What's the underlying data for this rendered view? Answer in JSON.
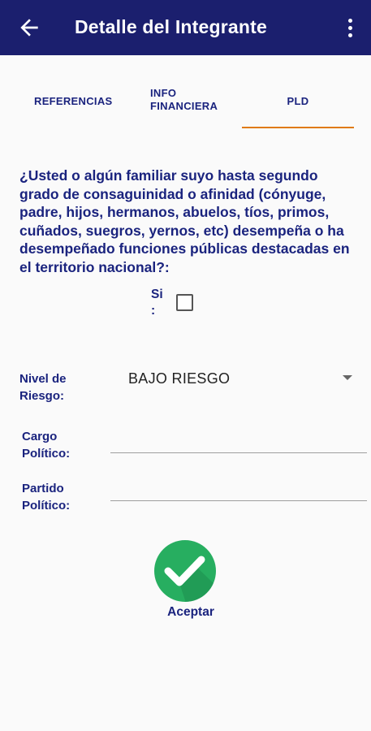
{
  "appbar": {
    "title": "Detalle del Integrante",
    "back_icon": "arrow-back-icon",
    "menu_icon": "more-vert-icon",
    "color": "#1b1f6e"
  },
  "tabs": [
    {
      "label": "REFERENCIAS",
      "selected": false
    },
    {
      "label_line1": "INFO",
      "label_line2": "FINANCIERA",
      "selected": false
    },
    {
      "label": "PLD",
      "selected": true
    }
  ],
  "tab_indicator_color": "#e07b12",
  "form": {
    "question": "¿Usted o algún familiar suyo hasta segundo grado de consaguinidad o afinidad (cónyuge, padre, hijos, hermanos, abuelos, tíos, primos, cuñados, suegros, yernos, etc) desempeña o ha desempeñado funciones públicas destacadas en el territorio nacional?:",
    "si_label": "Si",
    "si_colon": ":",
    "si_checked": false,
    "nivel_label_line1": "Nivel de",
    "nivel_label_line2": "Riesgo:",
    "nivel_value": "BAJO RIESGO",
    "cargo_label_line1": "Cargo",
    "cargo_label_line2": "Político:",
    "cargo_value": "",
    "partido_label_line1": "Partido",
    "partido_label_line2": "Político:",
    "partido_value": ""
  },
  "accept": {
    "label": "Aceptar",
    "icon": "check-icon",
    "color": "#27ae60"
  }
}
